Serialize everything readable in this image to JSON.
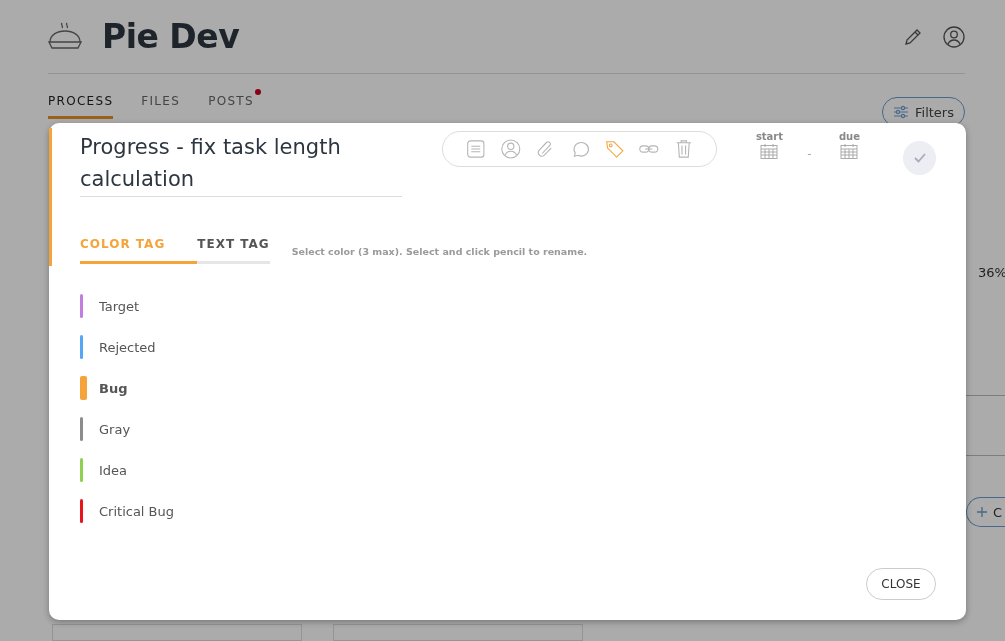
{
  "app": {
    "title": "Pie Dev"
  },
  "nav_tabs": [
    {
      "label": "PROCESS",
      "selected": true,
      "badge": false
    },
    {
      "label": "FILES",
      "selected": false,
      "badge": false
    },
    {
      "label": "POSTS",
      "selected": false,
      "badge": true
    }
  ],
  "filters_button": "Filters",
  "side_progress": "36%",
  "side_button": "C",
  "modal": {
    "title": "Progress - fix task length calculation",
    "tools": [
      {
        "kind": "notes",
        "selected": false
      },
      {
        "kind": "user",
        "selected": false
      },
      {
        "kind": "attach",
        "selected": false
      },
      {
        "kind": "comment",
        "selected": false
      },
      {
        "kind": "tag",
        "selected": true
      },
      {
        "kind": "link",
        "selected": false
      },
      {
        "kind": "delete",
        "selected": false
      }
    ],
    "start_label": "start",
    "separator": "-",
    "due_label": "due",
    "tag_tabs": [
      {
        "label": "COLOR TAG",
        "selected": true
      },
      {
        "label": "TEXT TAG",
        "selected": false
      }
    ],
    "hint": "Select color (3 max). Select and click pencil to rename.",
    "tags": [
      {
        "label": "Target",
        "color": "#c07fe0",
        "selected": false
      },
      {
        "label": "Rejected",
        "color": "#55a6f5",
        "selected": false
      },
      {
        "label": "Bug",
        "color": "#f4a43a",
        "selected": true
      },
      {
        "label": "Gray",
        "color": "#8c8c8c",
        "selected": false
      },
      {
        "label": "Idea",
        "color": "#8fd14f",
        "selected": false
      },
      {
        "label": "Critical Bug",
        "color": "#e8141c",
        "selected": false
      }
    ],
    "close_button": "CLOSE"
  }
}
